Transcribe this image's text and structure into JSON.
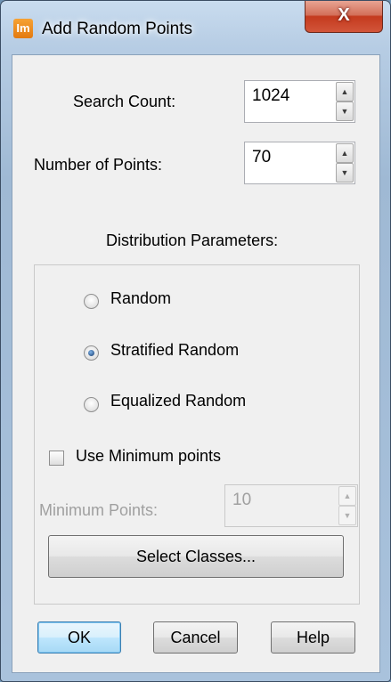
{
  "window": {
    "title": "Add Random Points",
    "app_icon_text": "Im",
    "close_glyph": "X"
  },
  "search_count": {
    "label": "Search Count:",
    "value": "1024"
  },
  "number_of_points": {
    "label": "Number of Points:",
    "value": "70"
  },
  "distribution": {
    "header": "Distribution Parameters:",
    "options": [
      {
        "label": "Random",
        "checked": false
      },
      {
        "label": "Stratified Random",
        "checked": true
      },
      {
        "label": "Equalized Random",
        "checked": false
      }
    ],
    "use_minimum": {
      "label": "Use Minimum points",
      "checked": false
    },
    "minimum_points": {
      "label": "Minimum Points:",
      "value": "10",
      "enabled": false
    },
    "select_classes_label": "Select Classes..."
  },
  "buttons": {
    "ok": "OK",
    "cancel": "Cancel",
    "help": "Help"
  },
  "icons": {
    "spin_up": "▲",
    "spin_down": "▼"
  }
}
